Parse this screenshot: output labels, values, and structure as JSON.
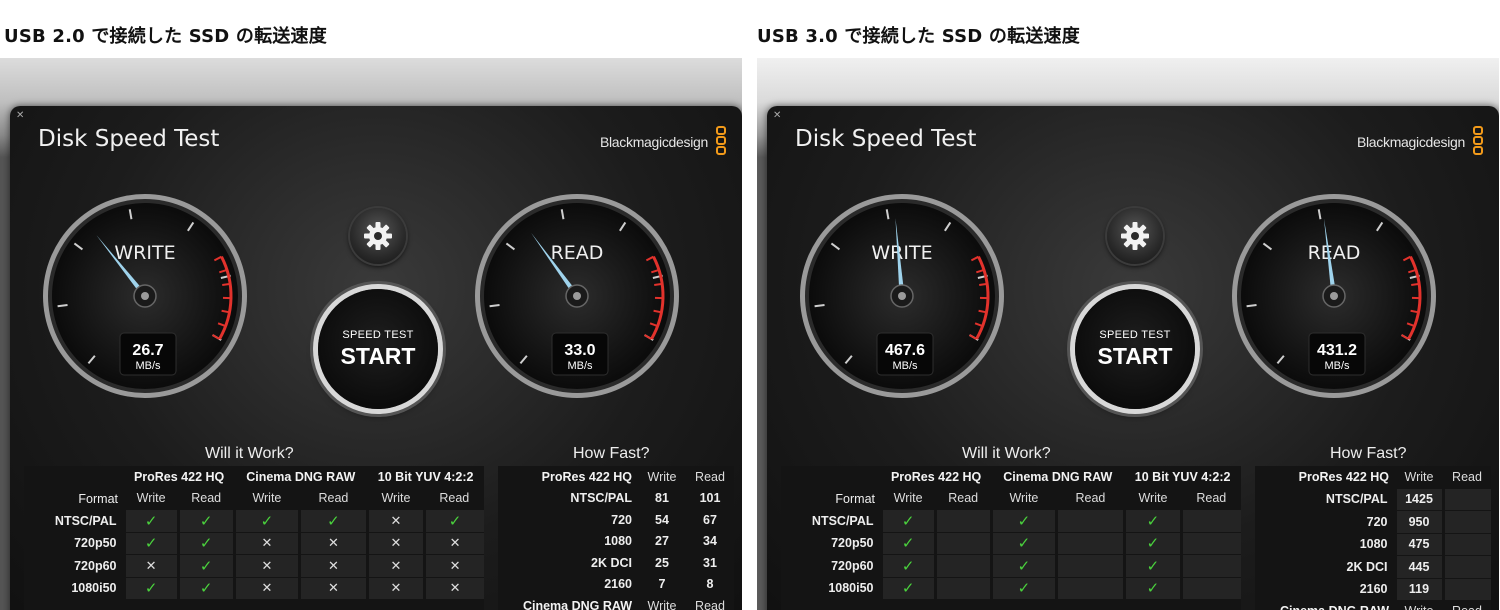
{
  "captions": {
    "left": "USB 2.0 で接続した SSD の転送速度",
    "right": "USB 3.0 で接続した SSD の転送速度"
  },
  "colors": {
    "accent_orange": "#f29a1a",
    "needle": "#9fd3ec",
    "redline": "#e2322c",
    "ok_green": "#4ad23d"
  },
  "app": {
    "title": "Disk Speed Test",
    "brand": "Blackmagicdesign",
    "icons": [
      "close-icon",
      "gear-icon",
      "blackmagic-logo-icon",
      "check-icon",
      "cross-icon",
      "mouse-cursor-icon"
    ],
    "write_label": "WRITE",
    "read_label": "READ",
    "unit": "MB/s",
    "start_small": "SPEED TEST",
    "start_big": "START",
    "will_it_work": "Will it Work?",
    "how_fast": "How Fast?",
    "codecs": [
      "ProRes 422 HQ",
      "Cinema DNG RAW",
      "10 Bit YUV 4:2:2"
    ],
    "format_header": "Format",
    "write_header": "Write",
    "read_header": "Read",
    "formats": [
      "NTSC/PAL",
      "720p50",
      "720p60",
      "1080i50"
    ],
    "howfast_codec": "ProRes 422 HQ",
    "howfast_formats": [
      "NTSC/PAL",
      "720",
      "1080",
      "2K DCI",
      "2160"
    ],
    "howfast_next_codec": "Cinema DNG RAW"
  },
  "tests": [
    {
      "write_value": "26.7",
      "read_value": "33.0",
      "write_fraction": 0.39,
      "read_fraction": 0.4,
      "will_work": [
        [
          "ok",
          "ok",
          "ok",
          "ok",
          "ng",
          "ok"
        ],
        [
          "ok",
          "ok",
          "ng",
          "ng",
          "ng",
          "ng"
        ],
        [
          "ng",
          "ok",
          "ng",
          "ng",
          "ng",
          "ng"
        ],
        [
          "ok",
          "ok",
          "ng",
          "ng",
          "ng",
          "ng"
        ]
      ],
      "how_fast": [
        [
          "81",
          "101"
        ],
        [
          "54",
          "67"
        ],
        [
          "27",
          "34"
        ],
        [
          "25",
          "31"
        ],
        [
          "7",
          "8"
        ]
      ]
    },
    {
      "write_value": "467.6",
      "read_value": "431.2",
      "write_fraction": 0.52,
      "read_fraction": 0.51,
      "will_work": [
        [
          "ok",
          "",
          "ok",
          "",
          "ok",
          ""
        ],
        [
          "ok",
          "",
          "ok",
          "",
          "ok",
          ""
        ],
        [
          "ok",
          "",
          "ok",
          "",
          "ok",
          ""
        ],
        [
          "ok",
          "",
          "ok",
          "",
          "ok",
          ""
        ]
      ],
      "how_fast": [
        [
          "1425",
          ""
        ],
        [
          "950",
          ""
        ],
        [
          "475",
          ""
        ],
        [
          "445",
          ""
        ],
        [
          "119",
          ""
        ]
      ]
    }
  ]
}
